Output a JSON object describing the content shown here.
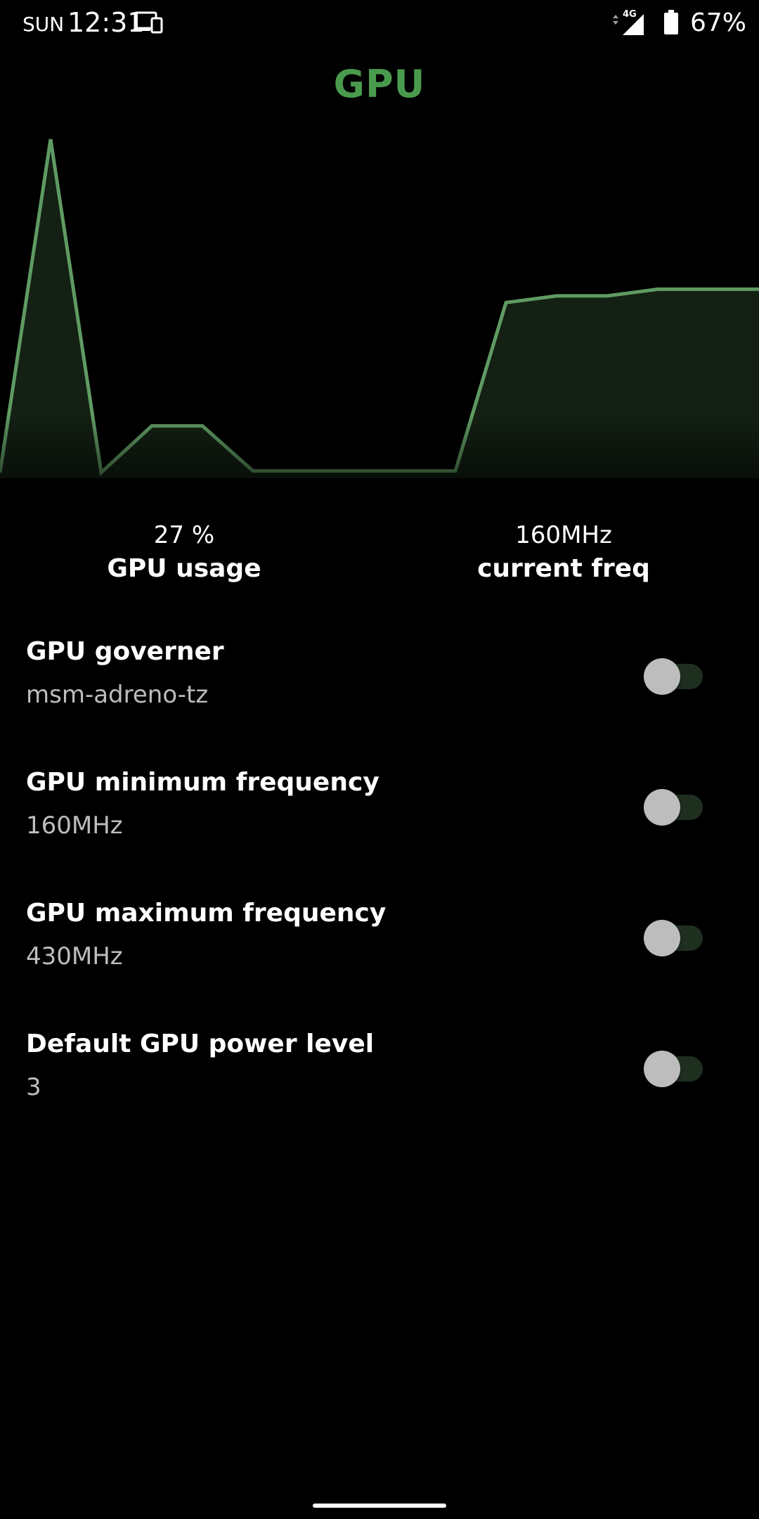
{
  "status_bar": {
    "day": "SUN",
    "time": "12:31",
    "network": "4G",
    "battery_percent": "67%",
    "icons": [
      "cast-icon",
      "signal-icon",
      "battery-icon"
    ]
  },
  "header": {
    "title": "GPU"
  },
  "colors": {
    "accent": "#4a9a4e",
    "chart_line": "#5f9a62",
    "chart_fill": "#132013",
    "background": "#000000",
    "secondary_text": "#bdbdbd"
  },
  "chart_data": {
    "type": "area",
    "title": "",
    "xlabel": "",
    "ylabel": "",
    "ylim": [
      0,
      100
    ],
    "grid": false,
    "series": [
      {
        "values": [
          0,
          100,
          0,
          14,
          14,
          0.5,
          0.5,
          0.5,
          0.5,
          0.5,
          51,
          53,
          53,
          55,
          55,
          55
        ]
      }
    ]
  },
  "stats": {
    "usage_value": "27 %",
    "usage_label": "GPU usage",
    "freq_value": "160MHz",
    "freq_label": "current freq"
  },
  "settings": [
    {
      "title": "GPU governer",
      "value": "msm-adreno-tz",
      "enabled": false
    },
    {
      "title": "GPU minimum frequency",
      "value": "160MHz",
      "enabled": false
    },
    {
      "title": "GPU maximum frequency",
      "value": "430MHz",
      "enabled": false
    },
    {
      "title": "Default GPU power level",
      "value": "3",
      "enabled": false
    }
  ]
}
